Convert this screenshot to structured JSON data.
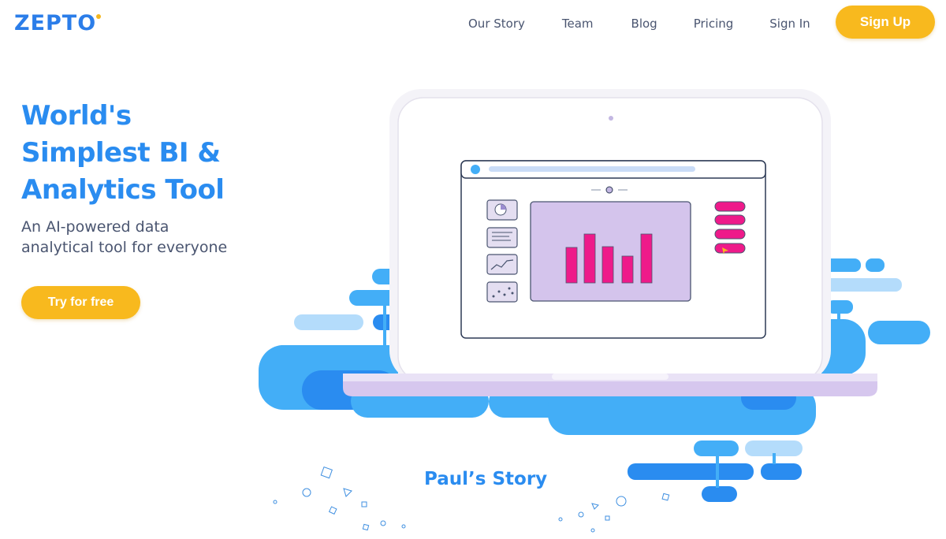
{
  "brand": {
    "name": "ZEPTO"
  },
  "nav": {
    "items": [
      {
        "label": "Our Story"
      },
      {
        "label": "Team"
      },
      {
        "label": "Blog"
      },
      {
        "label": "Pricing"
      },
      {
        "label": "Sign In"
      }
    ],
    "signup_label": "Sign Up"
  },
  "hero": {
    "title_line1": "World's",
    "title_line2": "Simplest BI &",
    "title_line3": "Analytics Tool",
    "subtitle_line1": "An AI-powered data",
    "subtitle_line2": "analytical tool for everyone",
    "cta_label": "Try for free"
  },
  "story": {
    "title": "Paul’s Story"
  },
  "colors": {
    "brand_blue": "#2b7de9",
    "accent_yellow": "#f8b91e",
    "cloud_blue": "#43aef7",
    "bar_pink": "#ee1a8a",
    "panel_lilac": "#d4c4ec"
  },
  "icons": [
    "pie-chart-icon",
    "table-icon",
    "line-chart-icon",
    "scatter-chart-icon"
  ]
}
